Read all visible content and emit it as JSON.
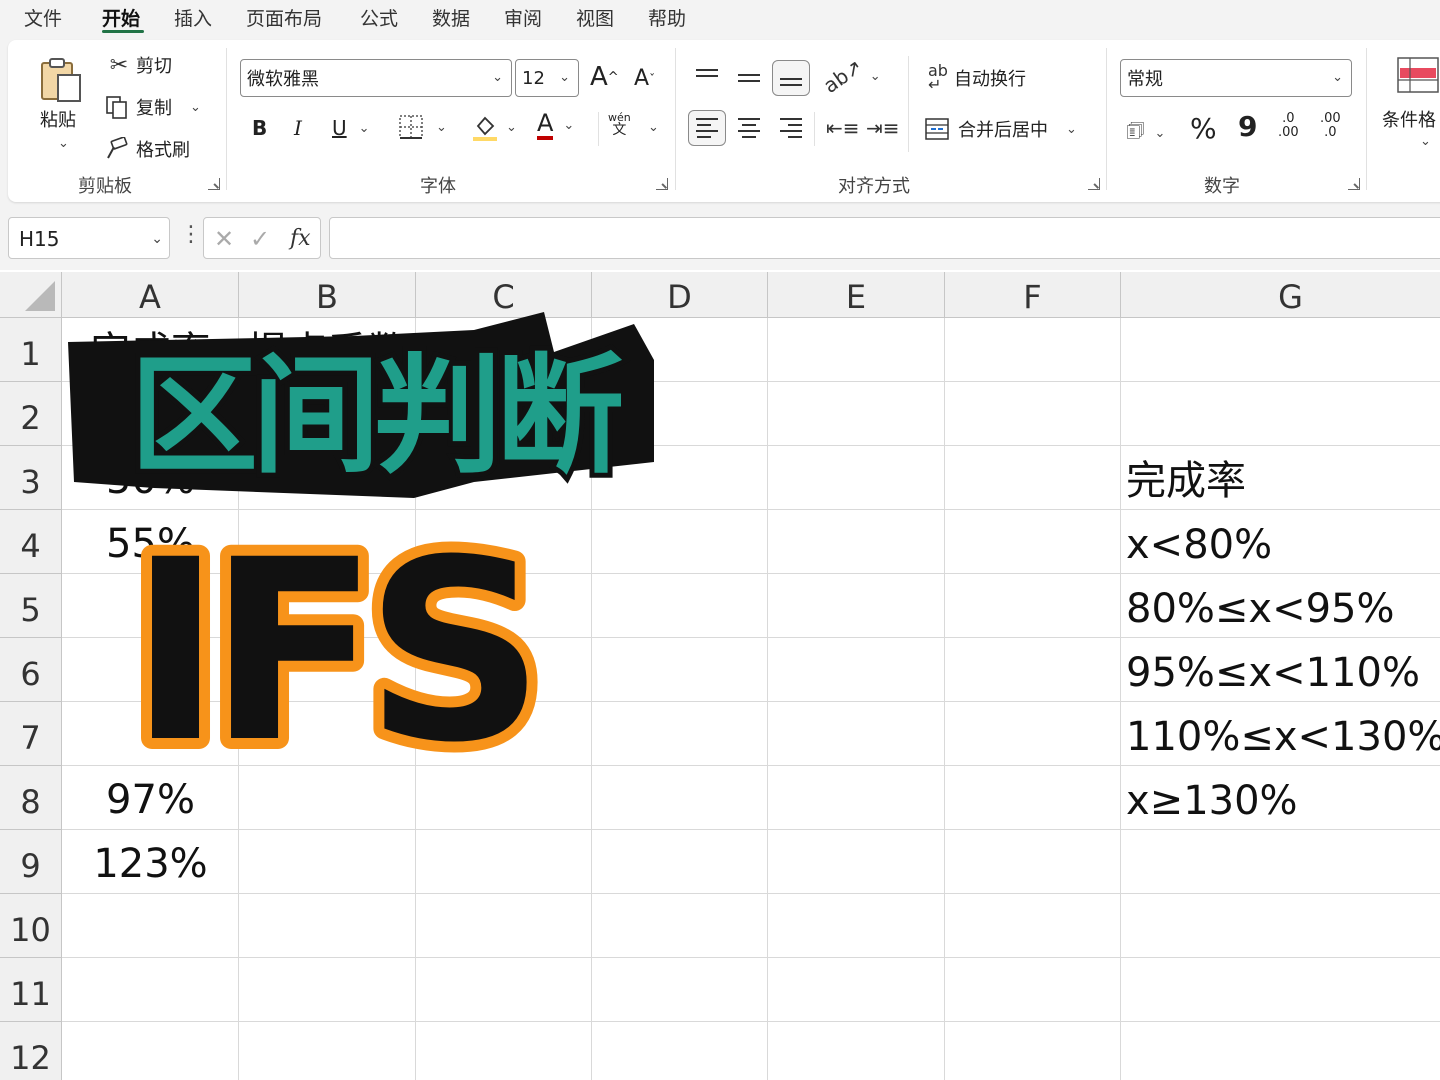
{
  "menu": {
    "items": [
      "文件",
      "开始",
      "插入",
      "页面布局",
      "公式",
      "数据",
      "审阅",
      "视图",
      "帮助"
    ],
    "active": "开始"
  },
  "ribbon": {
    "clipboard": {
      "paste": "粘贴",
      "cut": "剪切",
      "copy": "复制",
      "format_painter": "格式刷",
      "label": "剪贴板"
    },
    "font": {
      "family": "微软雅黑",
      "size": "12",
      "grow": "A",
      "shrink": "A",
      "bold": "B",
      "italic": "I",
      "underline": "U",
      "color_letter": "A",
      "phonetic": "wén",
      "phonetic_sub": "文",
      "label": "字体",
      "font_color": "#c00000",
      "fill_color": "#ffd966"
    },
    "alignment": {
      "wrap": "自动换行",
      "merge": "合并后居中",
      "label": "对齐方式"
    },
    "number": {
      "format": "常规",
      "percent": "%",
      "comma": "9",
      "inc_top": ".0",
      "inc_bot": ".00",
      "dec_top": ".00",
      "dec_bot": ".0",
      "label": "数字"
    },
    "styles": {
      "conditional": "条件格"
    }
  },
  "formula_bar": {
    "name_box": "H15",
    "fx": "fx",
    "content": ""
  },
  "sheet": {
    "columns": [
      "A",
      "B",
      "C",
      "D",
      "E",
      "F",
      "G"
    ],
    "rows": [
      "1",
      "2",
      "3",
      "4",
      "5",
      "6",
      "7",
      "8",
      "9",
      "10",
      "11",
      "12"
    ],
    "col_a": [
      "完成率",
      "",
      "50%",
      "55%",
      "",
      "",
      "",
      "97%",
      "123%"
    ],
    "col_b_header": "提点系数",
    "col_g": {
      "3": "完成率",
      "4": "x<80%",
      "5": "80%≤x<95%",
      "6": "95%≤x<110%",
      "7": "110%≤x<130%",
      "8": "x≥130%"
    }
  },
  "overlay": {
    "title_cn": "区间判断",
    "title_en": "IFS",
    "cn_fill": "#1f9e8a",
    "en_fill": "#111111",
    "en_stroke": "#f7931a",
    "outline": "#111111"
  },
  "colors": {
    "accent": "#217346",
    "gridline": "#d9d9d9",
    "header_bg": "#f0f0f0"
  }
}
